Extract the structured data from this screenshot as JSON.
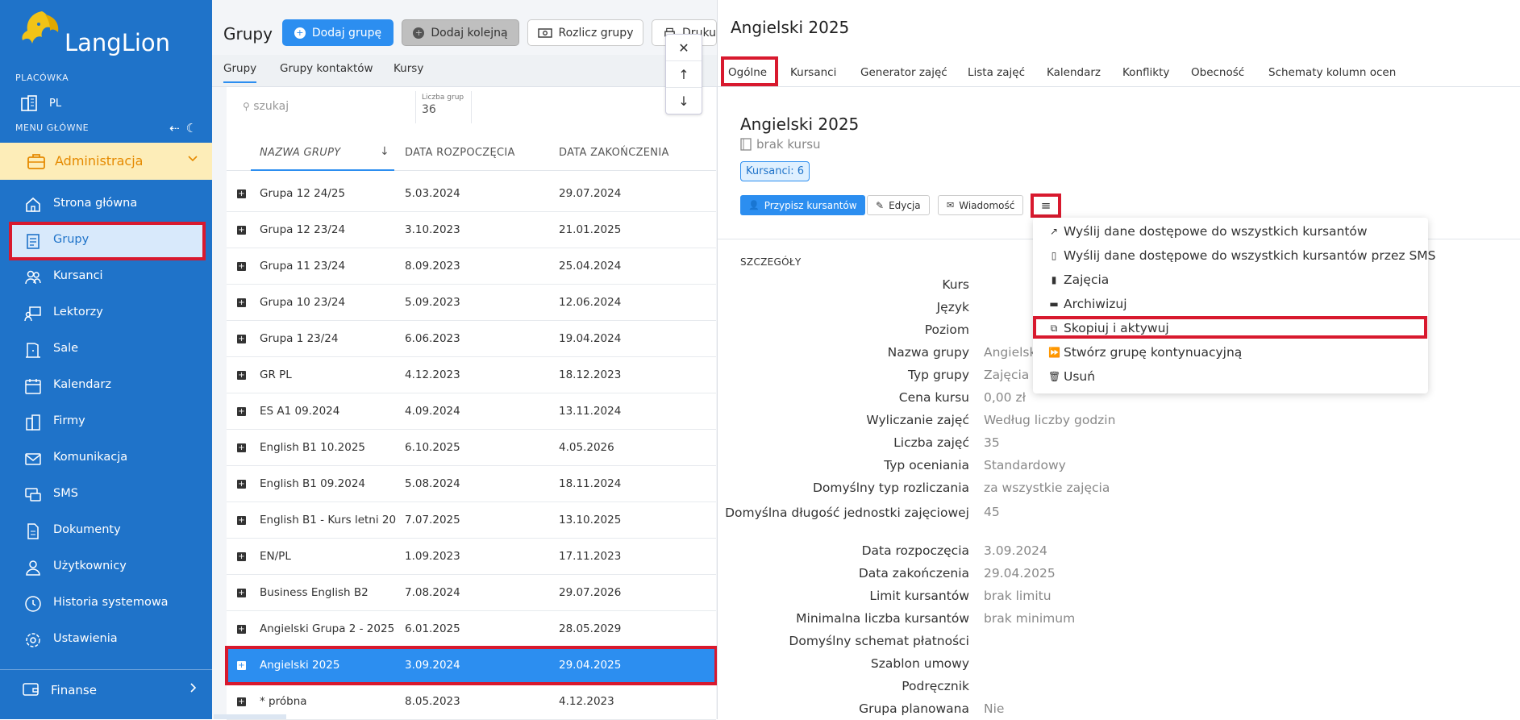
{
  "brand": {
    "name": "LangLion"
  },
  "sidebar": {
    "placowka_label": "PLACÓWKA",
    "placowka_value": "PL",
    "menu_label": "MENU GŁÓWNE",
    "section": "Administracja",
    "items": [
      {
        "label": "Strona główna",
        "icon": "home-icon"
      },
      {
        "label": "Grupy",
        "icon": "groups-icon"
      },
      {
        "label": "Kursanci",
        "icon": "students-icon"
      },
      {
        "label": "Lektorzy",
        "icon": "teacher-icon"
      },
      {
        "label": "Sale",
        "icon": "room-icon"
      },
      {
        "label": "Kalendarz",
        "icon": "calendar-icon"
      },
      {
        "label": "Firmy",
        "icon": "company-icon"
      },
      {
        "label": "Komunikacja",
        "icon": "mail-icon"
      },
      {
        "label": "SMS",
        "icon": "sms-icon"
      },
      {
        "label": "Dokumenty",
        "icon": "document-icon"
      },
      {
        "label": "Użytkownicy",
        "icon": "user-icon"
      },
      {
        "label": "Historia systemowa",
        "icon": "clock-icon"
      },
      {
        "label": "Ustawienia",
        "icon": "gear-icon"
      }
    ],
    "finanse": "Finanse"
  },
  "groups_panel": {
    "title": "Grupy",
    "buttons": {
      "add_group": "Dodaj grupę",
      "add_next": "Dodaj kolejną",
      "settle": "Rozlicz grupy",
      "print": "Druku"
    },
    "tabs": [
      "Grupy",
      "Grupy kontaktów",
      "Kursy"
    ],
    "search_placeholder": "szukaj",
    "count_label": "Liczba grup",
    "count_value": "36",
    "columns": [
      "NAZWA GRUPY",
      "DATA ROZPOCZĘCIA",
      "DATA ZAKOŃCZENIA"
    ],
    "rows": [
      {
        "name": "Grupa 12 24/25",
        "start": "5.03.2024",
        "end": "29.07.2024"
      },
      {
        "name": "Grupa 12 23/24",
        "start": "3.10.2023",
        "end": "21.01.2025"
      },
      {
        "name": "Grupa 11 23/24",
        "start": "8.09.2023",
        "end": "25.04.2024"
      },
      {
        "name": "Grupa 10 23/24",
        "start": "5.09.2023",
        "end": "12.06.2024"
      },
      {
        "name": "Grupa 1 23/24",
        "start": "6.06.2023",
        "end": "19.04.2024"
      },
      {
        "name": "GR PL",
        "start": "4.12.2023",
        "end": "18.12.2023"
      },
      {
        "name": "ES A1 09.2024",
        "start": "4.09.2024",
        "end": "13.11.2024"
      },
      {
        "name": "English B1 10.2025",
        "start": "6.10.2025",
        "end": "4.05.2026"
      },
      {
        "name": "English B1 09.2024",
        "start": "5.08.2024",
        "end": "18.11.2024"
      },
      {
        "name": "English B1 - Kurs letni 2025",
        "start": "7.07.2025",
        "end": "13.10.2025"
      },
      {
        "name": "EN/PL",
        "start": "1.09.2023",
        "end": "17.11.2023"
      },
      {
        "name": "Business English B2",
        "start": "7.08.2024",
        "end": "29.07.2026"
      },
      {
        "name": "Angielski Grupa 2 - 2025",
        "start": "6.01.2025",
        "end": "28.05.2029"
      },
      {
        "name": "Angielski 2025",
        "start": "3.09.2024",
        "end": "29.04.2025"
      },
      {
        "name": "* próbna",
        "start": "8.05.2023",
        "end": "4.12.2023"
      }
    ]
  },
  "detail": {
    "header": "Angielski 2025",
    "tabs": [
      "Ogólne",
      "Kursanci",
      "Generator zajęć",
      "Lista zajęć",
      "Kalendarz",
      "Konflikty",
      "Obecność",
      "Schematy kolumn ocen"
    ],
    "group_title": "Angielski 2025",
    "course": "brak kursu",
    "badge": "Kursanci: 6",
    "actions": {
      "assign": "Przypisz kursantów",
      "edit": "Edycja",
      "message": "Wiadomość"
    },
    "section_title": "SZCZEGÓŁY",
    "fields": [
      {
        "label": "Kurs",
        "value": ""
      },
      {
        "label": "Język",
        "value": ""
      },
      {
        "label": "Poziom",
        "value": ""
      },
      {
        "label": "Nazwa grupy",
        "value": "Angielsk"
      },
      {
        "label": "Typ grupy",
        "value": "Zajęcia g"
      },
      {
        "label": "Cena kursu",
        "value": "0,00 zł"
      },
      {
        "label": "Wyliczanie zajęć",
        "value": "Według liczby godzin"
      },
      {
        "label": "Liczba zajęć",
        "value": "35"
      },
      {
        "label": "Typ oceniania",
        "value": "Standardowy"
      },
      {
        "label": "Domyślny typ rozliczania",
        "value": "za wszystkie zajęcia"
      },
      {
        "label": "Domyślna długość jednostki zajęciowej",
        "value": "45"
      },
      {
        "label": "Data rozpoczęcia",
        "value": "3.09.2024"
      },
      {
        "label": "Data zakończenia",
        "value": "29.04.2025"
      },
      {
        "label": "Limit kursantów",
        "value": "brak limitu"
      },
      {
        "label": "Minimalna liczba kursantów",
        "value": "brak minimum"
      },
      {
        "label": "Domyślny schemat płatności",
        "value": ""
      },
      {
        "label": "Szablon umowy",
        "value": ""
      },
      {
        "label": "Podręcznik",
        "value": ""
      },
      {
        "label": "Grupa planowana",
        "value": "Nie"
      }
    ],
    "menu": [
      {
        "label": "Wyślij dane dostępowe do wszystkich kursantów",
        "icon": "share-icon"
      },
      {
        "label": "Wyślij dane dostępowe do wszystkich kursantów przez SMS",
        "icon": "mobile-icon"
      },
      {
        "label": "Zajęcia",
        "icon": "file-icon"
      },
      {
        "label": "Archiwizuj",
        "icon": "folder-icon"
      },
      {
        "label": "Skopiuj i aktywuj",
        "icon": "copy-icon"
      },
      {
        "label": "Stwórz grupę kontynuacyjną",
        "icon": "fast-forward-icon"
      },
      {
        "label": "Usuń",
        "icon": "trash-icon"
      }
    ]
  },
  "colors": {
    "sidebar": "#1f73c9",
    "accent": "#2c8ef0",
    "highlight": "#d8192e",
    "admin_bg": "#fdedb8",
    "admin_fg": "#e58a00"
  }
}
